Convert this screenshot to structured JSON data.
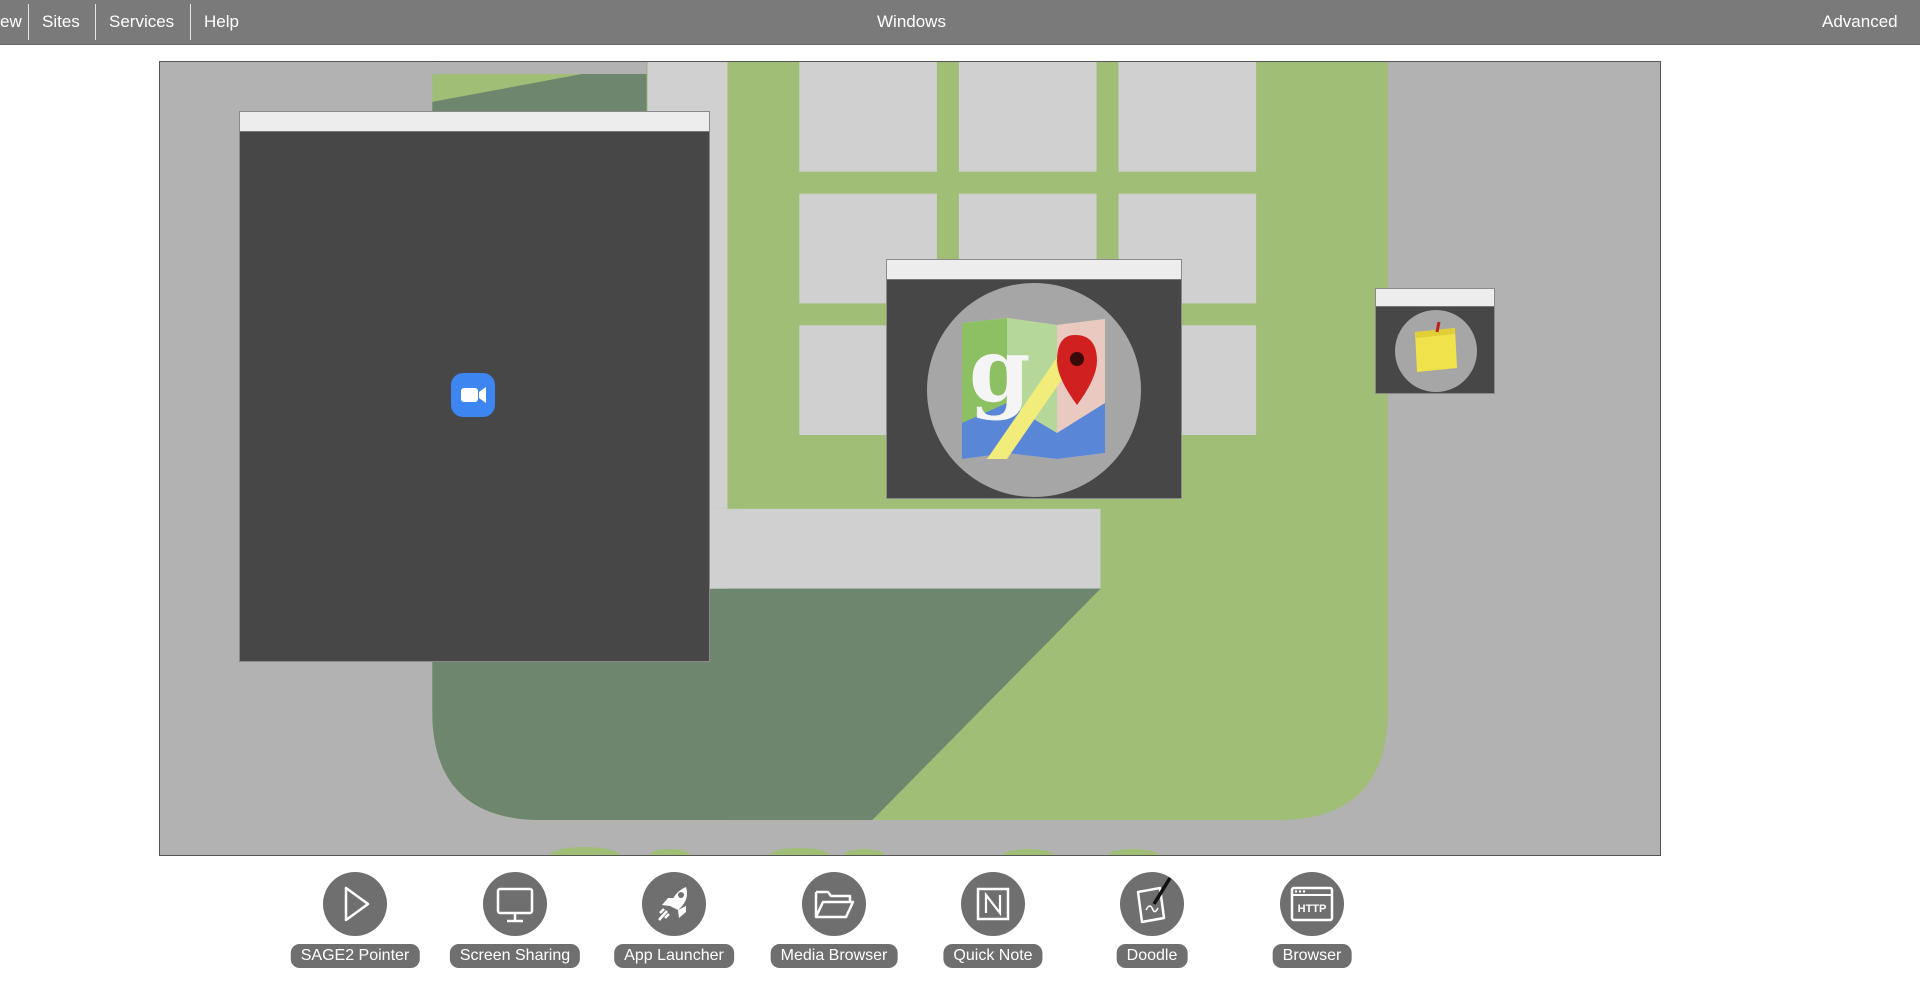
{
  "menu": {
    "items": [
      {
        "label": "ew"
      },
      {
        "label": "Sites"
      },
      {
        "label": "Services"
      },
      {
        "label": "Help"
      }
    ],
    "center_title": "Windows",
    "right_label": "Advanced"
  },
  "wall": {
    "windows": [
      {
        "app": "video-call",
        "icon": "video-camera-icon"
      },
      {
        "app": "maps",
        "icon": "google-maps-icon"
      },
      {
        "app": "quick-note",
        "icon": "sticky-note-icon"
      }
    ]
  },
  "toolbar": {
    "items": [
      {
        "label": "SAGE2 Pointer",
        "icon": "pointer-arrow-icon"
      },
      {
        "label": "Screen Sharing",
        "icon": "monitor-icon"
      },
      {
        "label": "App Launcher",
        "icon": "rocket-icon"
      },
      {
        "label": "Media Browser",
        "icon": "folder-icon"
      },
      {
        "label": "Quick Note",
        "icon": "note-n-icon"
      },
      {
        "label": "Doodle",
        "icon": "doodle-pen-icon"
      },
      {
        "label": "Browser",
        "icon": "http-browser-icon",
        "icon_text": "HTTP"
      }
    ]
  },
  "colors": {
    "menu_bar": "#7a7a7a",
    "wall_background": "#b2b2b2",
    "map_green": "#a0be76",
    "map_dark_green": "#6e856e",
    "building_gray": "#d0d0d0",
    "window_body": "#474747",
    "toolbar_button": "#6f6f6f"
  }
}
